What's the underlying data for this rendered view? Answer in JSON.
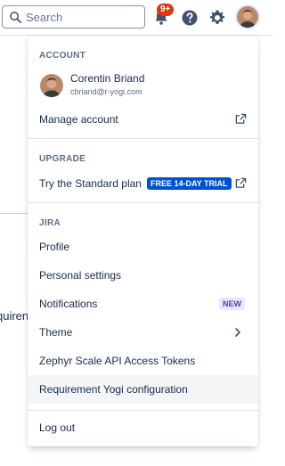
{
  "search": {
    "placeholder": "Search"
  },
  "notifications": {
    "badge": "9+"
  },
  "background": {
    "partial_text": "quiren"
  },
  "menu": {
    "account": {
      "title": "ACCOUNT",
      "name": "Corentin Briand",
      "email": "cbriand@r-yogi.com",
      "manage": "Manage account"
    },
    "upgrade": {
      "title": "UPGRADE",
      "try_plan": "Try the Standard plan",
      "trial_badge": "FREE 14-DAY TRIAL"
    },
    "jira": {
      "title": "JIRA",
      "items": [
        {
          "label": "Profile"
        },
        {
          "label": "Personal settings"
        },
        {
          "label": "Notifications",
          "badge": "NEW"
        },
        {
          "label": "Theme"
        },
        {
          "label": "Zephyr Scale API Access Tokens"
        },
        {
          "label": "Requirement Yogi configuration"
        }
      ]
    },
    "logout": "Log out"
  },
  "colors": {
    "accent": "#0052cc",
    "badge_red": "#de350b",
    "new_badge_text": "#5243aa",
    "new_badge_bg": "#eae6ff",
    "highlight": "#f4f5f7"
  }
}
